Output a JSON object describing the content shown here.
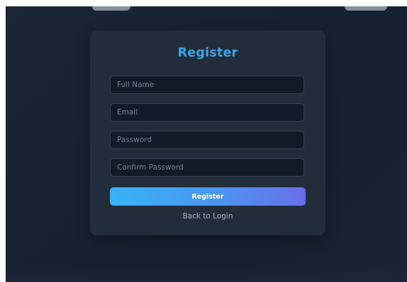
{
  "form": {
    "title": "Register",
    "fields": [
      {
        "placeholder": "Full Name",
        "value": ""
      },
      {
        "placeholder": "Email",
        "value": ""
      },
      {
        "placeholder": "Password",
        "value": ""
      },
      {
        "placeholder": "Confirm Password",
        "value": ""
      }
    ],
    "submit_label": "Register",
    "back_link_label": "Back to Login"
  },
  "colors": {
    "background": "#172131",
    "card": "#222d3c",
    "title": "#3ba4e2",
    "input_background": "#131b29",
    "button_gradient_start": "#37b3f7",
    "button_gradient_end": "#6a6ee8"
  }
}
